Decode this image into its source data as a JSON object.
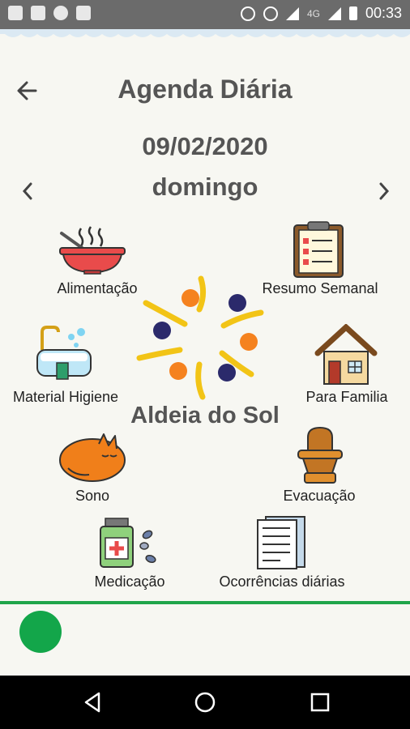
{
  "status_bar": {
    "time": "00:33",
    "network": "4G"
  },
  "header": {
    "title": "Agenda Diária",
    "date": "09/02/2020",
    "weekday": "domingo"
  },
  "logo": {
    "name": "Aldeia do Sol"
  },
  "menu": {
    "alimentacao": "Alimentação",
    "resumo_semanal": "Resumo Semanal",
    "material_higiene": "Material Higiene",
    "para_familia": "Para Familia",
    "sono": "Sono",
    "evacuacao": "Evacuação",
    "medicacao": "Medicação",
    "ocorrencias": "Ocorrências diárias"
  },
  "colors": {
    "accent_green": "#13a64a",
    "title_gray": "#555555",
    "logo_orange": "#f5821f",
    "logo_navy": "#2b2a6b",
    "logo_yellow": "#f2c416"
  },
  "icons": [
    "back-arrow-icon",
    "chevron-left-icon",
    "chevron-right-icon",
    "bowl-icon",
    "clipboard-icon",
    "bathtub-icon",
    "house-icon",
    "sleeping-cat-icon",
    "potty-icon",
    "medicine-icon",
    "document-icon"
  ]
}
